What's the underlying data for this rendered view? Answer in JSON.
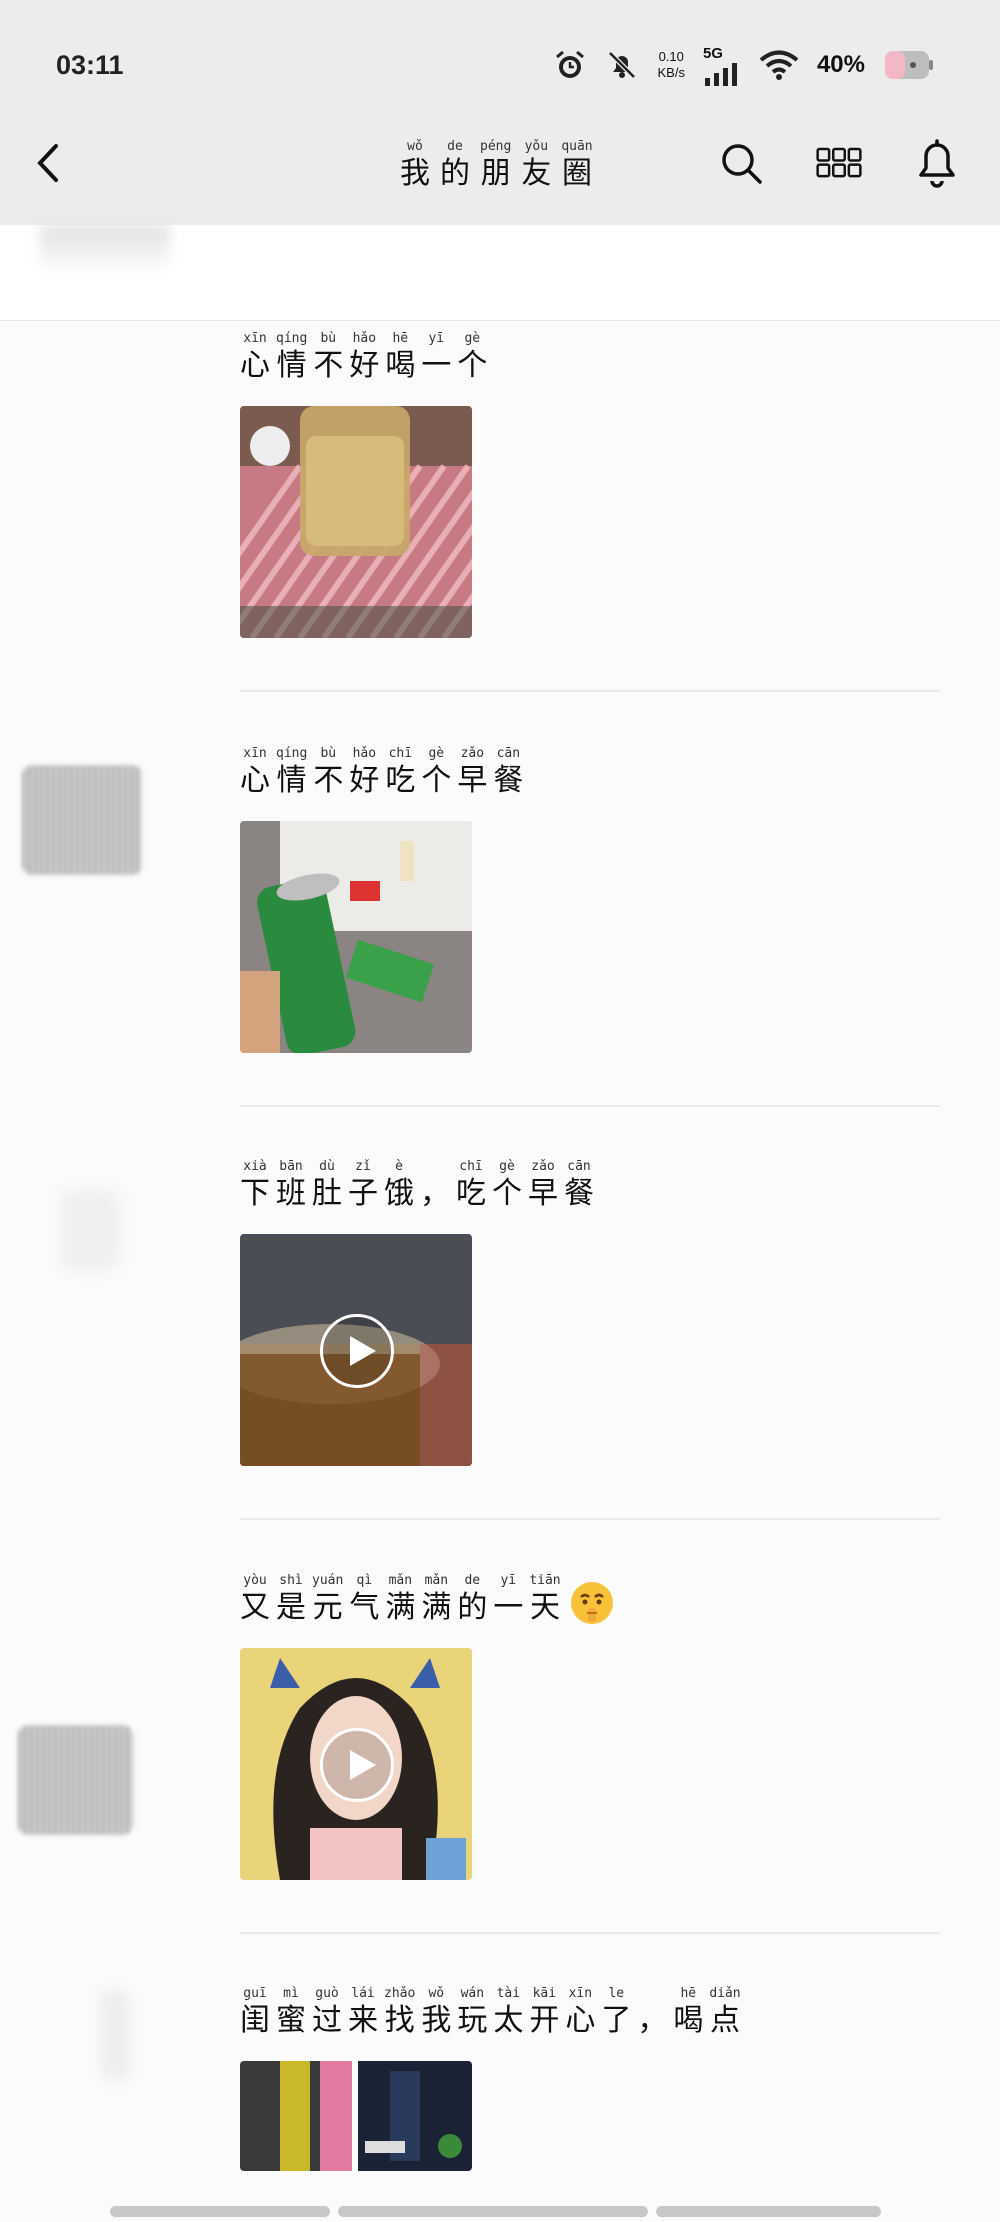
{
  "status": {
    "time": "03:11",
    "net_speed": "0.10",
    "net_unit": "KB/s",
    "signal": "5G",
    "battery": "40%"
  },
  "nav": {
    "title_hanzi": [
      "我",
      "的",
      "朋",
      "友",
      "圈"
    ],
    "title_pinyin": [
      "wǒ",
      "de",
      "péng",
      "yǒu",
      "quān"
    ]
  },
  "posts": [
    {
      "hanzi": [
        "心",
        "情",
        "不",
        "好",
        "喝",
        "一",
        "个"
      ],
      "pinyin": [
        "xīn",
        "qíng",
        "bù",
        "hǎo",
        "hē",
        "yī",
        "gè"
      ],
      "media": "photo",
      "emoji": ""
    },
    {
      "hanzi": [
        "心",
        "情",
        "不",
        "好",
        "吃",
        "个",
        "早",
        "餐"
      ],
      "pinyin": [
        "xīn",
        "qíng",
        "bù",
        "hǎo",
        "chī",
        "gè",
        "zǎo",
        "cān"
      ],
      "media": "photo",
      "emoji": ""
    },
    {
      "hanzi": [
        "下",
        "班",
        "肚",
        "子",
        "饿",
        "，",
        "吃",
        "个",
        "早",
        "餐"
      ],
      "pinyin": [
        "xià",
        "bān",
        "dù",
        "zǐ",
        "è",
        "",
        "chī",
        "gè",
        "zǎo",
        "cān"
      ],
      "media": "video",
      "emoji": ""
    },
    {
      "hanzi": [
        "又",
        "是",
        "元",
        "气",
        "满",
        "满",
        "的",
        "一",
        "天"
      ],
      "pinyin": [
        "yòu",
        "shì",
        "yuán",
        "qì",
        "mǎn",
        "mǎn",
        "de",
        "yī",
        "tiān"
      ],
      "media": "video",
      "emoji": "shushing-face-emoji"
    },
    {
      "hanzi": [
        "闺",
        "蜜",
        "过",
        "来",
        "找",
        "我",
        "玩",
        "太",
        "开",
        "心",
        "了",
        "，",
        "喝",
        "点"
      ],
      "pinyin": [
        "guī",
        "mì",
        "guò",
        "lái",
        "zhǎo",
        "wǒ",
        "wán",
        "tài",
        "kāi",
        "xīn",
        "le",
        "",
        "hē",
        "diǎn"
      ],
      "media": "photo-pair",
      "emoji": ""
    }
  ]
}
